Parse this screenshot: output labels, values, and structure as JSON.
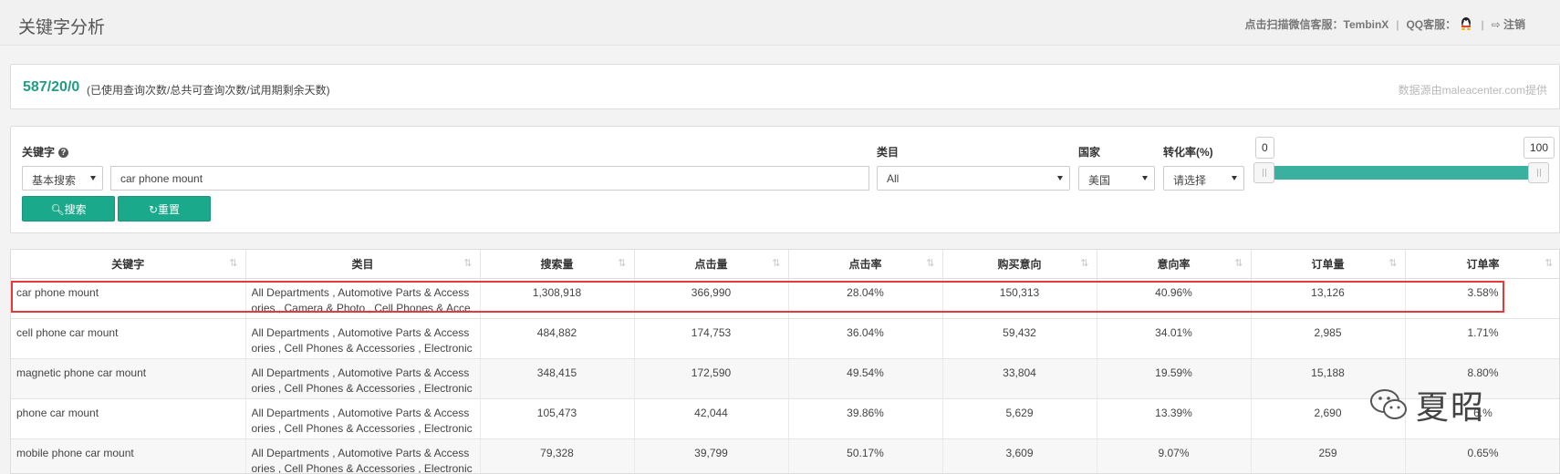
{
  "header": {
    "title": "关键字分析",
    "wechat_label": "点击扫描微信客服：",
    "wechat_name": "TembinX",
    "qq_label": "QQ客服：",
    "logout_label": "注销"
  },
  "quota": {
    "numbers": "587/20/0",
    "description": "(已使用查询次数/总共可查询次数/试用期剩余天数)",
    "source": "数据源由maleacenter.com提供"
  },
  "filters": {
    "keyword_label": "关键字",
    "search_mode": "基本搜索",
    "keyword_value": "car phone mount",
    "category_label": "类目",
    "category_value": "All",
    "country_label": "国家",
    "country_value": "美国",
    "conversion_label": "转化率(%)",
    "conversion_value": "请选择",
    "slider_min": "0",
    "slider_max": "100",
    "search_button": "搜索",
    "reset_button": "重置"
  },
  "table": {
    "columns": [
      "关键字",
      "类目",
      "搜索量",
      "点击量",
      "点击率",
      "购买意向",
      "意向率",
      "订单量",
      "订单率"
    ],
    "rows": [
      {
        "keyword": "car phone mount",
        "category": "All Departments , Automotive Parts & Accessories , Camera & Photo , Cell Phones & Accessories",
        "search": "1,308,918",
        "clicks": "366,990",
        "ctr": "28.04%",
        "intent": "150,313",
        "intent_rate": "40.96%",
        "orders": "13,126",
        "order_rate": "3.58%"
      },
      {
        "keyword": "cell phone car mount",
        "category": "All Departments , Automotive Parts & Accessories , Cell Phones & Accessories , Electronics",
        "search": "484,882",
        "clicks": "174,753",
        "ctr": "36.04%",
        "intent": "59,432",
        "intent_rate": "34.01%",
        "orders": "2,985",
        "order_rate": "1.71%"
      },
      {
        "keyword": "magnetic phone car mount",
        "category": "All Departments , Automotive Parts & Accessories , Cell Phones & Accessories , Electronics",
        "search": "348,415",
        "clicks": "172,590",
        "ctr": "49.54%",
        "intent": "33,804",
        "intent_rate": "19.59%",
        "orders": "15,188",
        "order_rate": "8.80%"
      },
      {
        "keyword": "phone car mount",
        "category": "All Departments , Automotive Parts & Accessories , Cell Phones & Accessories , Electronics",
        "search": "105,473",
        "clicks": "42,044",
        "ctr": "39.86%",
        "intent": "5,629",
        "intent_rate": "13.39%",
        "orders": "2,690",
        "order_rate": "6.%"
      },
      {
        "keyword": "mobile phone car mount",
        "category": "All Departments , Automotive Parts & Accessories , Cell Phones & Accessories , Electronics",
        "search": "79,328",
        "clicks": "39,799",
        "ctr": "50.17%",
        "intent": "3,609",
        "intent_rate": "9.07%",
        "orders": "259",
        "order_rate": "0.65%"
      }
    ]
  },
  "watermark": {
    "text": "夏昭"
  },
  "colors": {
    "accent": "#1aa98b",
    "highlight": "#e33a3a",
    "quota": "#1f9e84"
  }
}
